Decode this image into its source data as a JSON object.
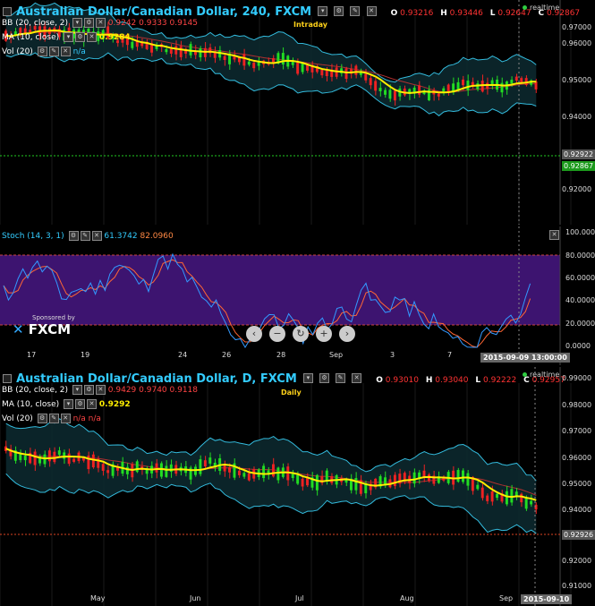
{
  "top_chart": {
    "title": "Australian Dollar/Canadian Dollar, 240, FXCM",
    "ohlc": {
      "o_label": "O",
      "o": "0.93216",
      "h_label": "H",
      "h": "0.93446",
      "l_label": "L",
      "l": "0.92647",
      "c_label": "C",
      "c": "0.92867"
    },
    "tag": "Intraday",
    "realtime": "realtime",
    "indicators": {
      "bb": {
        "label": "BB (20, close, 2)",
        "values": "0.9242  0.9333  0.9145"
      },
      "ma": {
        "label": "MA (10, close)",
        "value": "0.9284"
      },
      "vol": {
        "label": "Vol (20)",
        "value": "n/a"
      }
    },
    "price_labels": [
      "0.97000",
      "0.96000",
      "0.95000",
      "0.94000",
      "0.92000"
    ],
    "current_price": "0.92922",
    "current_price_2": "0.92867"
  },
  "stoch": {
    "label": "Stoch (14, 3, 1)",
    "k": "61.3742",
    "d": "82.0960",
    "levels": [
      "100.0000",
      "80.0000",
      "60.0000",
      "40.0000",
      "20.0000",
      "0.0000"
    ],
    "x_labels": [
      "17",
      "19",
      "24",
      "26",
      "28",
      "Sep",
      "3",
      "7"
    ],
    "date_tag": "2015-09-09 13:00:00",
    "sponsor": "Sponsored by",
    "brand": "FXCM",
    "nav": [
      "‹",
      "−",
      "↻",
      "+",
      "›"
    ]
  },
  "bottom_chart": {
    "title": "Australian Dollar/Canadian Dollar, D, FXCM",
    "ohlc": {
      "o_label": "O",
      "o": "0.93010",
      "h_label": "H",
      "h": "0.93040",
      "l_label": "L",
      "l": "0.92222",
      "c_label": "C",
      "c": "0.92957"
    },
    "tag": "Daily",
    "realtime": "realtime",
    "indicators": {
      "bb": {
        "label": "BB (20, close, 2)",
        "values": "0.9429  0.9740  0.9118"
      },
      "ma": {
        "label": "MA (10, close)",
        "value": "0.9292"
      },
      "vol": {
        "label": "Vol (20)",
        "value": "n/a  n/a"
      }
    },
    "price_labels": [
      "0.99000",
      "0.98000",
      "0.97000",
      "0.96000",
      "0.95000",
      "0.94000",
      "0.92000",
      "0.91000"
    ],
    "current_price": "0.92926",
    "x_labels": [
      "May",
      "Jun",
      "Jul",
      "Aug",
      "Sep"
    ],
    "date_tag": "2015-09-10"
  },
  "colors": {
    "bull": "#22dd22",
    "bear": "#ee2222",
    "ma": "#ffee00",
    "bb": "#33bbdd",
    "stoch_bg": "#3d1470",
    "k": "#3399ff",
    "d": "#ff6633"
  }
}
